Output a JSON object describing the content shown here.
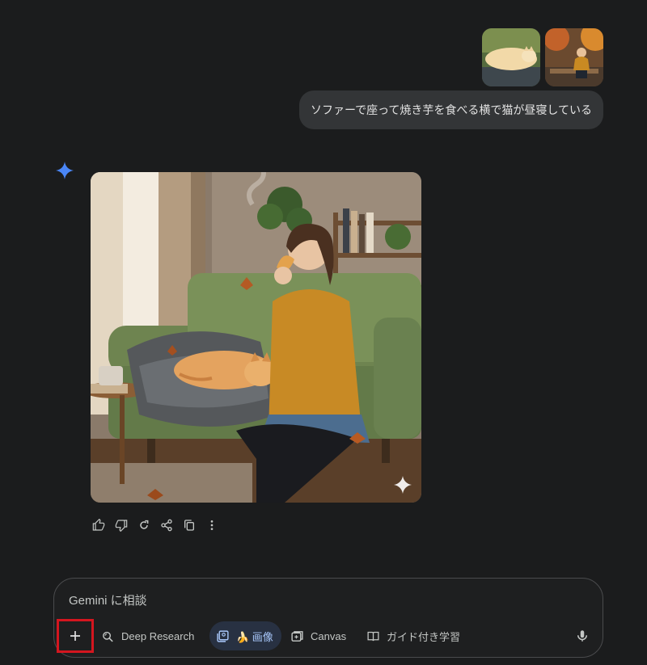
{
  "chat": {
    "user_message": "ソファーで座って焼き芋を食べる横で猫が昼寝している",
    "attachments": [
      "cat-sleeping-thumbnail",
      "woman-autumn-thumbnail"
    ]
  },
  "response": {
    "image_alt": "generated-image-woman-eating-sweet-potato-with-sleeping-cat",
    "actions": [
      "thumbs-up-icon",
      "thumbs-down-icon",
      "regenerate-icon",
      "share-icon",
      "copy-icon",
      "more-vert-icon"
    ]
  },
  "composer": {
    "placeholder": "Gemini に相談",
    "tools": {
      "deep_research": "Deep Research",
      "image": "🍌 画像",
      "canvas": "Canvas",
      "guided_learning": "ガイド付き学習"
    }
  },
  "colors": {
    "background": "#1b1c1d",
    "bubble": "#333537",
    "accent_blue": "#a8c7fa",
    "highlight_red": "#d4161f"
  }
}
